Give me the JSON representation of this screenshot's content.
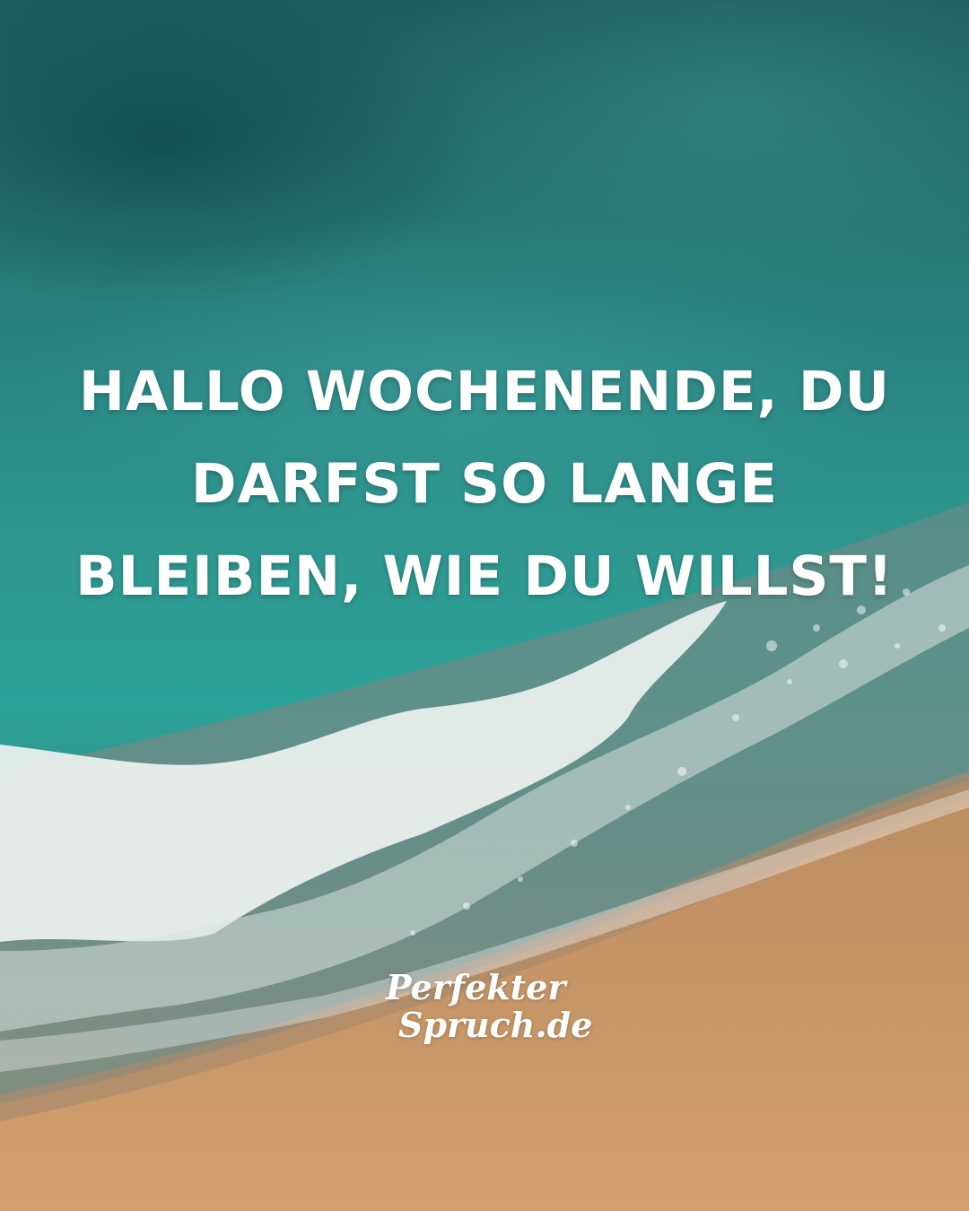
{
  "quote": {
    "lines": [
      "HALLO WOCHENENDE, DU",
      "DARFST SO LANGE",
      "BLEIBEN, WIE DU WILLST!"
    ]
  },
  "logo": {
    "line1": "Perfekter",
    "line2": "Spruch.de"
  },
  "colors": {
    "deep_water": "#1d5d5c",
    "turquoise": "#2aa39a",
    "foam": "#e9eeec",
    "sand": "#cf9d6c",
    "text": "#ffffff"
  }
}
